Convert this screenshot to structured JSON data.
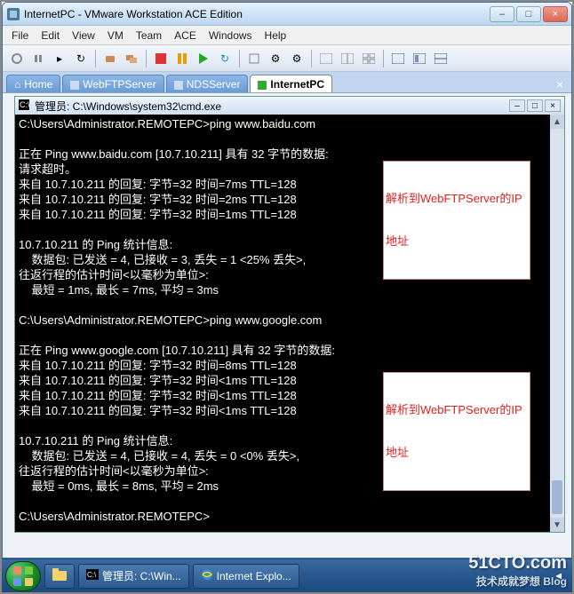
{
  "window": {
    "title": "InternetPC - VMware Workstation ACE Edition",
    "buttons": {
      "min": "–",
      "max": "□",
      "close": "×"
    }
  },
  "menu": [
    "File",
    "Edit",
    "View",
    "VM",
    "Team",
    "ACE",
    "Windows",
    "Help"
  ],
  "tabs": {
    "home": "Home",
    "webftp": "WebFTPServer",
    "nds": "NDSServer",
    "active": "InternetPC",
    "close": "×"
  },
  "cmd": {
    "title": "管理员: C:\\Windows\\system32\\cmd.exe",
    "lines": [
      "C:\\Users\\Administrator.REMOTEPC>ping www.baidu.com",
      "",
      "正在 Ping www.baidu.com [10.7.10.211] 具有 32 字节的数据:",
      "请求超时。",
      "来自 10.7.10.211 的回复: 字节=32 时间=7ms TTL=128",
      "来自 10.7.10.211 的回复: 字节=32 时间=2ms TTL=128",
      "来自 10.7.10.211 的回复: 字节=32 时间=1ms TTL=128",
      "",
      "10.7.10.211 的 Ping 统计信息:",
      "    数据包: 已发送 = 4, 已接收 = 3, 丢失 = 1 <25% 丢失>,",
      "往返行程的估计时间<以毫秒为单位>:",
      "    最短 = 1ms, 最长 = 7ms, 平均 = 3ms",
      "",
      "C:\\Users\\Administrator.REMOTEPC>ping www.google.com",
      "",
      "正在 Ping www.google.com [10.7.10.211] 具有 32 字节的数据:",
      "来自 10.7.10.211 的回复: 字节=32 时间=8ms TTL=128",
      "来自 10.7.10.211 的回复: 字节=32 时间<1ms TTL=128",
      "来自 10.7.10.211 的回复: 字节=32 时间<1ms TTL=128",
      "来自 10.7.10.211 的回复: 字节=32 时间<1ms TTL=128",
      "",
      "10.7.10.211 的 Ping 统计信息:",
      "    数据包: 已发送 = 4, 已接收 = 4, 丢失 = 0 <0% 丢失>,",
      "往返行程的估计时间<以毫秒为单位>:",
      "    最短 = 0ms, 最长 = 8ms, 平均 = 2ms",
      "",
      "C:\\Users\\Administrator.REMOTEPC>"
    ]
  },
  "annotations": {
    "a1_l1": "解析到WebFTPServer的IP",
    "a1_l2": "地址",
    "a2_l1": "解析到WebFTPServer的IP",
    "a2_l2": "地址"
  },
  "taskbar": {
    "item1": "管理员: C:\\Win...",
    "item2": "Internet Explo..."
  },
  "watermark": {
    "main": "51CTO.com",
    "sub": "技术成就梦想 Blog"
  }
}
